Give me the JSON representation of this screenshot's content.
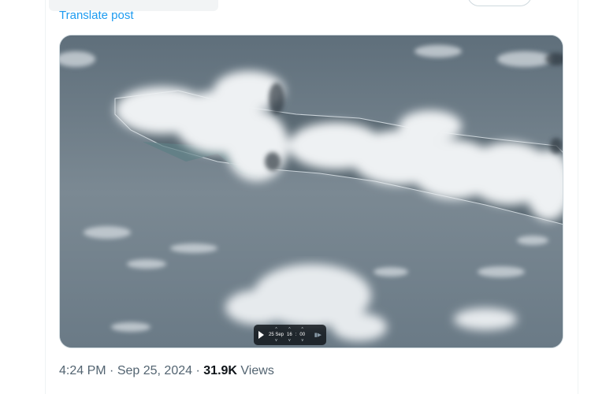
{
  "post": {
    "translate_label": "Translate post",
    "time": "4:24 PM",
    "date": "Sep 25, 2024",
    "views_count": "31.9K",
    "views_label": "Views",
    "separator": "·"
  },
  "player": {
    "date": "25 Sep",
    "hour": "16",
    "colon": ":",
    "minute": "00",
    "up_arrow": "^",
    "down_arrow": "v"
  },
  "icons": {
    "play": "play-icon",
    "skip": "skip-end-icon"
  },
  "colors": {
    "link": "#1d9bf0",
    "secondary_text": "#536471",
    "primary_text": "#0f1419"
  }
}
